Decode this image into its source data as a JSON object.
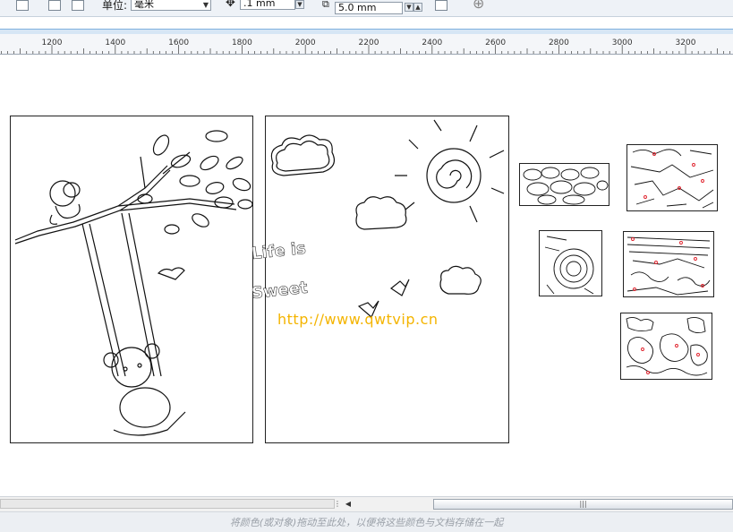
{
  "toolbar": {
    "units_label": "单位:",
    "units_value": "毫米",
    "nudge_value": ".1 mm",
    "duplicate_distance": "5.0 mm"
  },
  "ruler": {
    "labels": [
      "1200",
      "1400",
      "1600",
      "1800",
      "2000",
      "2200",
      "2400",
      "2600",
      "2800",
      "3000",
      "3200"
    ]
  },
  "canvas": {
    "watermark": "http://www.qwtvip.cn",
    "text_life": "Life is",
    "text_sweet": "Sweet"
  },
  "statusbar": {
    "hint": "将颜色(或对象)拖动至此处，以便将这些颜色与文档存储在一起"
  },
  "colors": {
    "ruler_bg": "#f4f6f9",
    "accent_strip": "#d6e6f5",
    "watermark": "#f4b400",
    "marker_red": "#e0202a"
  }
}
